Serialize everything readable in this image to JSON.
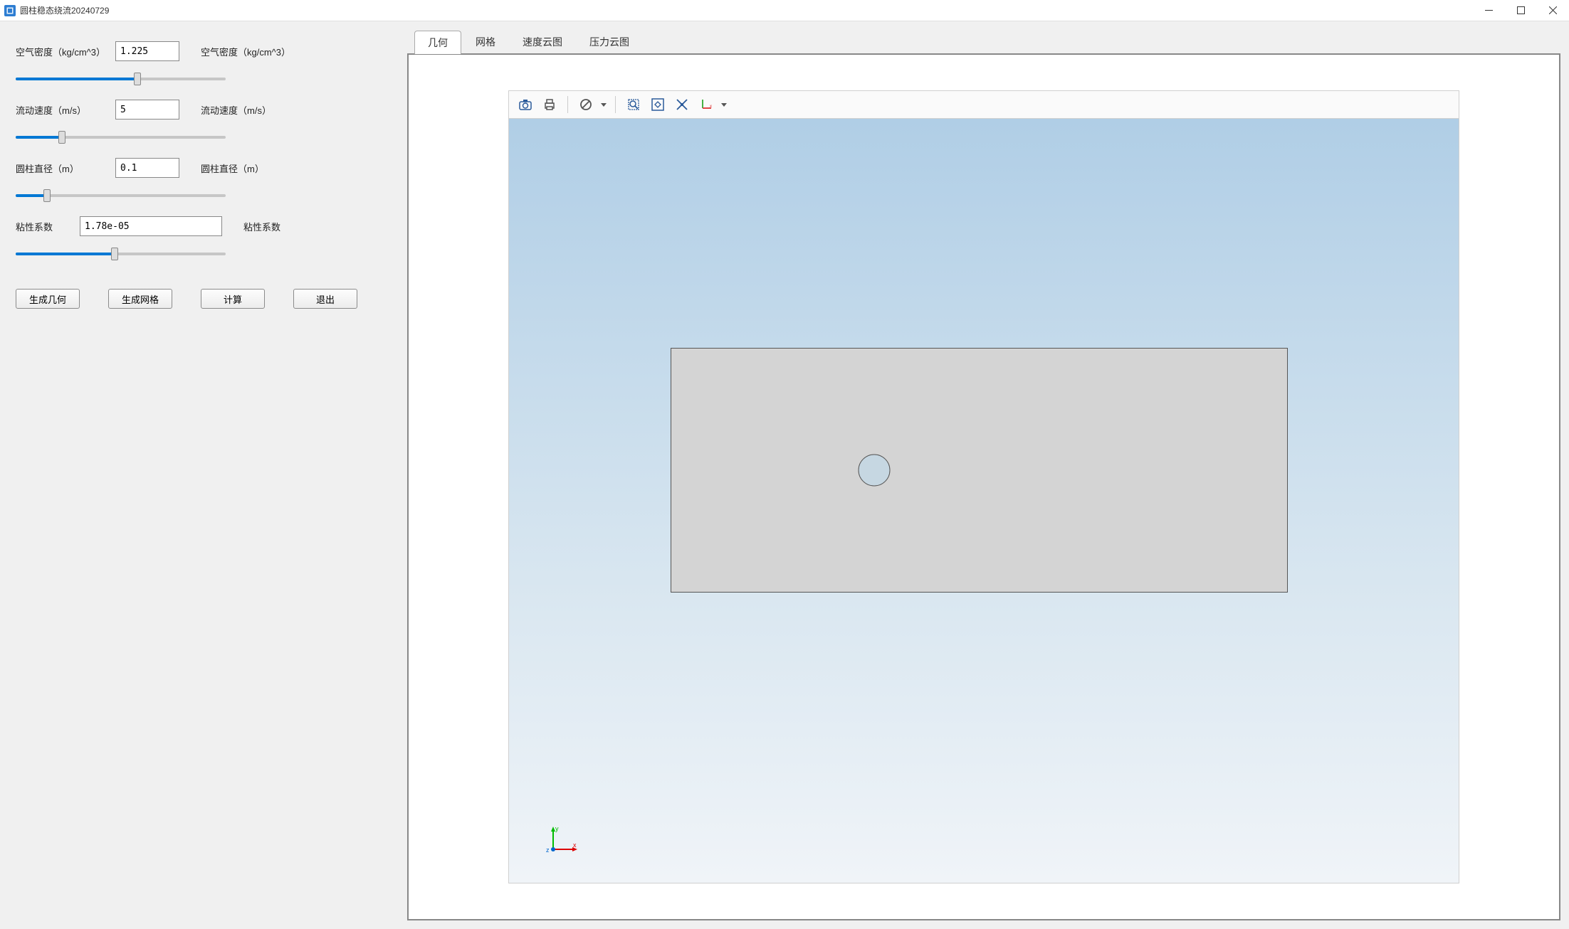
{
  "window": {
    "title": "圆柱稳态绕流20240729"
  },
  "params": {
    "density": {
      "label_left": "空气密度（kg/cm^3）",
      "value": "1.225",
      "label_right": "空气密度（kg/cm^3）",
      "slider_pct": 58
    },
    "velocity": {
      "label_left": "流动速度（m/s）",
      "value": "5",
      "label_right": "流动速度（m/s）",
      "slider_pct": 22
    },
    "diameter": {
      "label_left": "圆柱直径（m）",
      "value": "0.1",
      "label_right": "圆柱直径（m）",
      "slider_pct": 15
    },
    "viscosity": {
      "label_left": "粘性系数",
      "value": "1.78e-05",
      "label_right": "粘性系数",
      "slider_pct": 47
    }
  },
  "buttons": {
    "gen_geom": "生成几何",
    "gen_mesh": "生成网格",
    "compute": "计算",
    "exit": "退出"
  },
  "tabs": {
    "geometry": "几何",
    "mesh": "网格",
    "velocity_contour": "速度云图",
    "pressure_contour": "压力云图"
  },
  "axis": {
    "x": "x",
    "y": "y",
    "z": "z"
  }
}
